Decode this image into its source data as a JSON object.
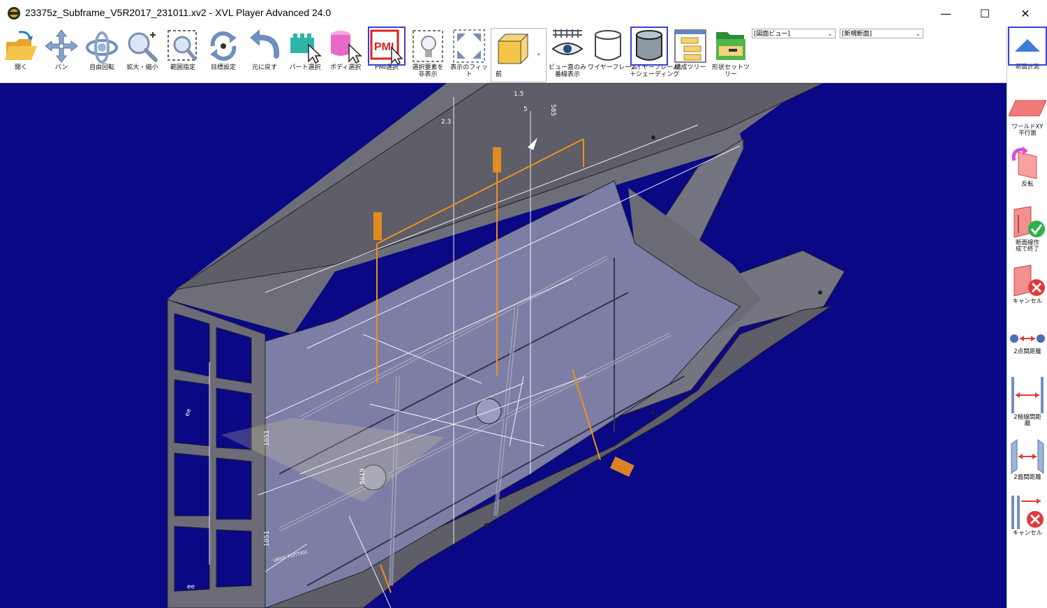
{
  "window": {
    "title": "23375z_Subframe_V5R2017_231011.xv2 - XVL Player Advanced 24.0",
    "minimize": "—",
    "maximize": "☐",
    "close": "✕"
  },
  "toolbar": {
    "items": [
      {
        "label": "開く",
        "icon": "open-folder-icon"
      },
      {
        "label": "パン",
        "icon": "pan-icon"
      },
      {
        "label": "自由回転",
        "icon": "free-rotate-icon"
      },
      {
        "label": "拡大・縮小",
        "icon": "zoom-icon"
      },
      {
        "label": "範囲指定",
        "icon": "zoom-area-icon"
      },
      {
        "label": "目標設定",
        "icon": "target-icon"
      },
      {
        "label": "元に戻す",
        "icon": "undo-icon"
      },
      {
        "label": "パート選択",
        "icon": "part-select-icon"
      },
      {
        "label": "ボディ選択",
        "icon": "body-select-icon"
      },
      {
        "label": "PMI選択",
        "icon": "pmi-select-icon"
      },
      {
        "label": "選択要素を\n非表示",
        "icon": "hide-selected-icon"
      },
      {
        "label": "表示のフィッ\nト",
        "icon": "fit-view-icon"
      },
      {
        "label": "ビュー直のみ\n番線表示",
        "icon": "view-eye-icon"
      },
      {
        "label": "ワイヤーフレーム",
        "icon": "wireframe-icon"
      },
      {
        "label": "ワイヤーフレーム\n＋シェーディング",
        "icon": "wireframe-shading-icon"
      },
      {
        "label": "構成ツリー",
        "icon": "tree-icon"
      },
      {
        "label": "形状セットツ\nリー",
        "icon": "shape-set-tree-icon"
      }
    ],
    "view_dropdown": "前",
    "combo_view": "[図面ビュー]",
    "combo_section": "[新規断面]",
    "section_measure": "断面計測"
  },
  "right_panel": {
    "items": [
      {
        "label": "ワールドXY\n平行面",
        "icon": "world-xy-plane-icon"
      },
      {
        "label": "反転",
        "icon": "flip-icon"
      },
      {
        "label": "断面線作\n成で終了",
        "icon": "finish-section-icon"
      },
      {
        "label": "キャンセル",
        "icon": "cancel-section-icon"
      },
      {
        "label": "2点間距離",
        "icon": "two-point-distance-icon"
      },
      {
        "label": "2稜線間距\n離",
        "icon": "two-edge-distance-icon"
      },
      {
        "label": "2面間距離",
        "icon": "two-face-distance-icon"
      },
      {
        "label": "キャンセル",
        "icon": "cancel-measure-icon"
      }
    ]
  },
  "colors": {
    "viewport_bg": "#0a0885",
    "part_face": "#7c7ea6",
    "part_dark": "#55566b",
    "pmi_orange": "#f0901c",
    "selection": "#3a3fd6"
  },
  "model": {
    "pmi_texts": [
      "1.5",
      "5",
      "585",
      "2.3",
      "ee",
      "100",
      "1051",
      "8019",
      "LB005 T02TT001"
    ]
  }
}
